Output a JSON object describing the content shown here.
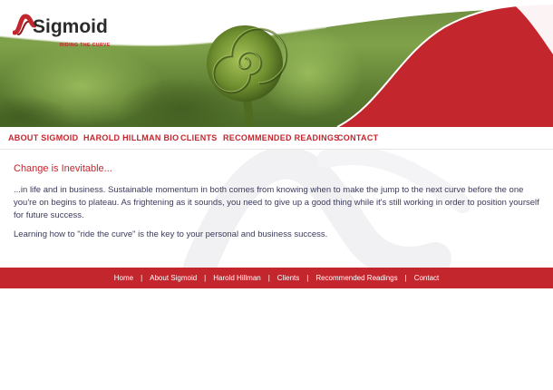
{
  "brand": {
    "name": "Sigmoid",
    "tagline": "RIDING THE CURVE"
  },
  "colors": {
    "accent": "#c4262e",
    "text": "#3a3a5c"
  },
  "nav": {
    "items": [
      {
        "label": "ABOUT SIGMOID"
      },
      {
        "label": "HAROLD HILLMAN BIO"
      },
      {
        "label": "CLIENTS"
      },
      {
        "label": "RECOMMENDED READINGS"
      },
      {
        "label": "CONTACT"
      }
    ]
  },
  "main": {
    "heading": "Change is Inevitable...",
    "paragraph1": "...in life and in business. Sustainable momentum in both comes from knowing when to make the jump to the next curve before the one you're on begins to plateau. As frightening as it sounds, you need to give up a good thing while it's still working in order to position yourself for future success.",
    "paragraph2": "Learning how to \"ride the curve\" is the key to your personal and business success."
  },
  "footer": {
    "links": [
      {
        "label": "Home"
      },
      {
        "label": "About Sigmoid"
      },
      {
        "label": "Harold Hillman"
      },
      {
        "label": "Clients"
      },
      {
        "label": "Recommended Readings"
      },
      {
        "label": "Contact"
      }
    ],
    "separator": "|"
  }
}
